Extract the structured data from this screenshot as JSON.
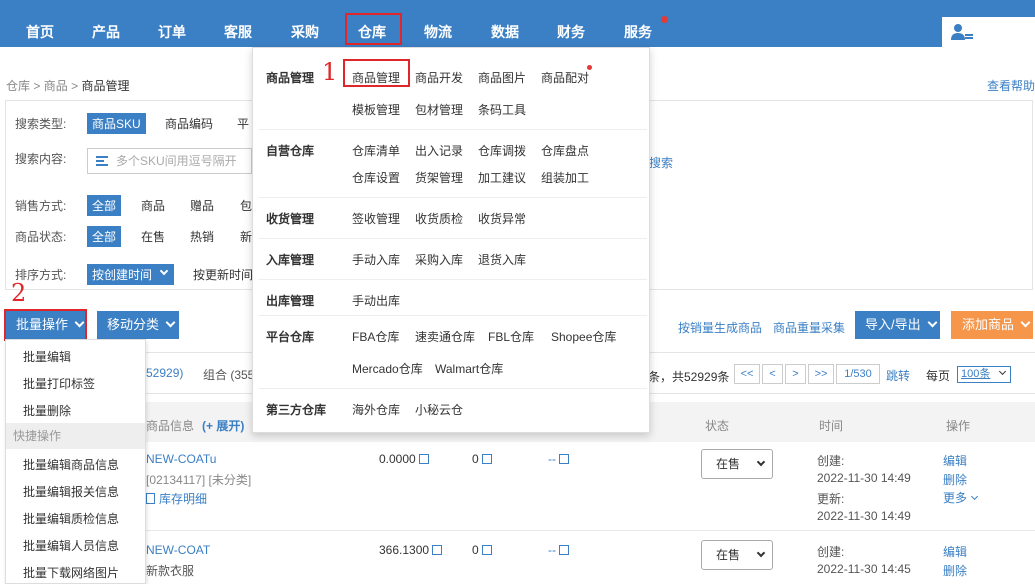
{
  "nav": {
    "items": [
      "首页",
      "产品",
      "订单",
      "客服",
      "采购",
      "仓库",
      "物流",
      "数据",
      "财务",
      "服务"
    ],
    "active": "仓库"
  },
  "breadcrumb": {
    "p1": "仓库",
    "p2": "商品",
    "current": "商品管理",
    "sep": ">"
  },
  "help": "查看帮助",
  "filters": {
    "search_type_label": "搜索类型:",
    "search_types": [
      "商品SKU",
      "商品编码",
      "平"
    ],
    "search_content_label": "搜索内容:",
    "search_placeholder": "多个SKU间用逗号隔开",
    "search_link": "搜索",
    "sales_label": "销售方式:",
    "sales_opts": [
      "全部",
      "商品",
      "赠品",
      "包"
    ],
    "status_label": "商品状态:",
    "status_opts": [
      "全部",
      "在售",
      "热销",
      "新"
    ],
    "sort_label": "排序方式:",
    "sort_opts": [
      "按创建时间",
      "按更新时间"
    ]
  },
  "annotations": {
    "one": "1",
    "two": "2"
  },
  "toolbar": {
    "batch": "批量操作",
    "move": "移动分类",
    "link1": "按销量生成商品",
    "link2": "商品重量采集",
    "import_export": "导入/导出",
    "add": "添加商品"
  },
  "batch_menu": {
    "items": [
      "批量编辑",
      "批量打印标签",
      "批量删除"
    ],
    "quick_header": "快捷操作",
    "quick_items": [
      "批量编辑商品信息",
      "批量编辑报关信息",
      "批量编辑质检信息",
      "批量编辑人员信息",
      "批量下载网络图片"
    ]
  },
  "tabs": {
    "t1_suffix": "52929)",
    "t2": "组合 (355"
  },
  "pager": {
    "summary": "条，共52929条",
    "first": "<<",
    "prev": "<",
    "next": ">",
    "last": ">>",
    "page": "1/530",
    "jump": "跳转",
    "per_page_label": "每页",
    "per_page": "100条"
  },
  "table": {
    "headers": {
      "info": "商品信息",
      "expand": "(+ 展开)",
      "status": "状态",
      "time": "时间",
      "action": "操作"
    },
    "rows": [
      {
        "name": "NEW-COATu",
        "sub": "[02134117] [未分类]",
        "stock_link": "库存明细",
        "price": "0.0000",
        "qty": "0",
        "dash": "--",
        "status": "在售",
        "created_label": "创建:",
        "created": "2022-11-30 14:49",
        "updated_label": "更新:",
        "updated": "2022-11-30 14:49",
        "edit": "编辑",
        "delete": "删除",
        "more": "更多"
      },
      {
        "name": "NEW-COAT",
        "sub": "新款衣服",
        "price": "366.1300",
        "qty": "0",
        "dash": "--",
        "status": "在售",
        "created_label": "创建:",
        "created": "2022-11-30 14:45",
        "edit": "编辑",
        "delete": "删除"
      }
    ]
  },
  "mega": {
    "cats": [
      "商品管理",
      "自营仓库",
      "收货管理",
      "入库管理",
      "出库管理",
      "平台仓库",
      "第三方仓库"
    ],
    "goods": [
      "商品管理",
      "商品开发",
      "商品图片",
      "商品配对",
      "模板管理",
      "包材管理",
      "条码工具"
    ],
    "self_wh": [
      "仓库清单",
      "出入记录",
      "仓库调拨",
      "仓库盘点",
      "仓库设置",
      "货架管理",
      "加工建议",
      "组装加工"
    ],
    "receive": [
      "签收管理",
      "收货质检",
      "收货异常"
    ],
    "inbound": [
      "手动入库",
      "采购入库",
      "退货入库"
    ],
    "outbound": [
      "手动出库"
    ],
    "platform": [
      "FBA仓库",
      "速卖通仓库",
      "FBL仓库",
      "Shopee仓库",
      "Mercado仓库",
      "Walmart仓库"
    ],
    "third": [
      "海外仓库",
      "小秘云仓"
    ]
  },
  "colors": {
    "nav": "#3b7fc4",
    "accent_red": "#e0262a",
    "orange": "#f5964a"
  }
}
